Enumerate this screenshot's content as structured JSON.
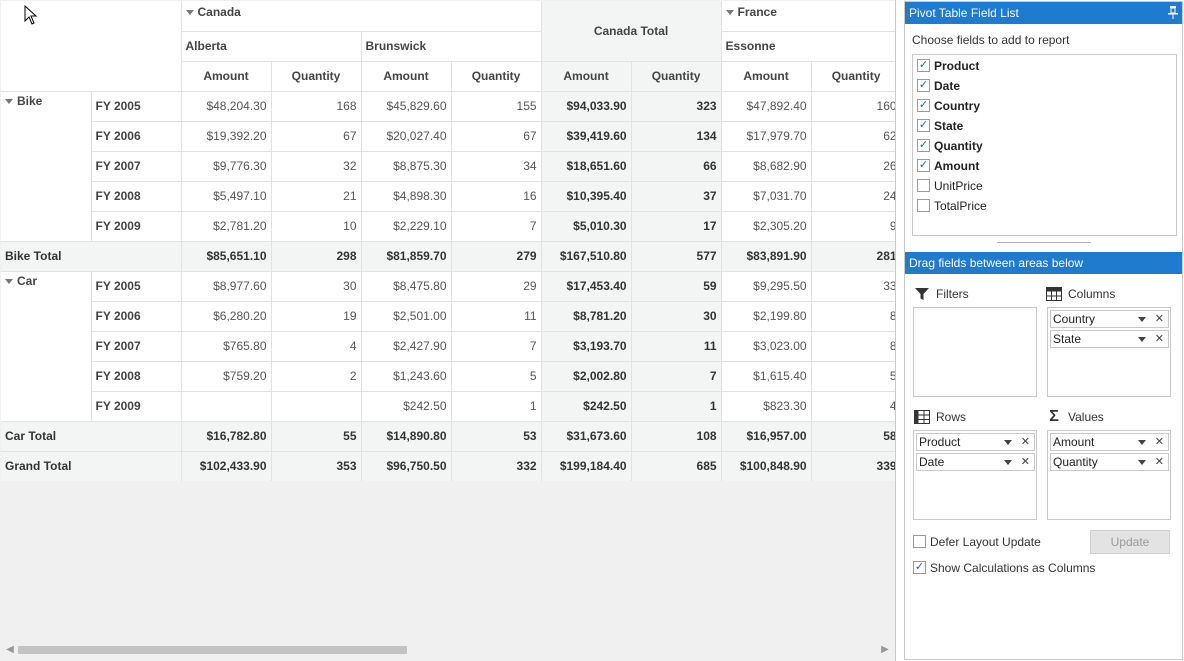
{
  "grid": {
    "col_groups": {
      "canada": "Canada",
      "canada_total": "Canada Total",
      "france": "France"
    },
    "states": {
      "alberta": "Alberta",
      "brunswick": "Brunswick",
      "essonne": "Essonne"
    },
    "measures": {
      "amount": "Amount",
      "quantity": "Quantity"
    },
    "rows": [
      {
        "product": "Bike",
        "year": "FY 2005",
        "values": [
          "$48,204.30",
          "168",
          "$45,829.60",
          "155",
          "$94,033.90",
          "323",
          "$47,892.40",
          "160"
        ]
      },
      {
        "product": "",
        "year": "FY 2006",
        "values": [
          "$19,392.20",
          "67",
          "$20,027.40",
          "67",
          "$39,419.60",
          "134",
          "$17,979.70",
          "62"
        ]
      },
      {
        "product": "",
        "year": "FY 2007",
        "values": [
          "$9,776.30",
          "32",
          "$8,875.30",
          "34",
          "$18,651.60",
          "66",
          "$8,682.90",
          "26"
        ]
      },
      {
        "product": "",
        "year": "FY 2008",
        "values": [
          "$5,497.10",
          "21",
          "$4,898.30",
          "16",
          "$10,395.40",
          "37",
          "$7,031.70",
          "24"
        ]
      },
      {
        "product": "",
        "year": "FY 2009",
        "values": [
          "$2,781.20",
          "10",
          "$2,229.10",
          "7",
          "$5,010.30",
          "17",
          "$2,305.20",
          "9"
        ]
      },
      {
        "total": "Bike Total",
        "values": [
          "$85,651.10",
          "298",
          "$81,859.70",
          "279",
          "$167,510.80",
          "577",
          "$83,891.90",
          "281"
        ]
      },
      {
        "product": "Car",
        "year": "FY 2005",
        "values": [
          "$8,977.60",
          "30",
          "$8,475.80",
          "29",
          "$17,453.40",
          "59",
          "$9,295.50",
          "33"
        ]
      },
      {
        "product": "",
        "year": "FY 2006",
        "values": [
          "$6,280.20",
          "19",
          "$2,501.00",
          "11",
          "$8,781.20",
          "30",
          "$2,199.80",
          "8"
        ]
      },
      {
        "product": "",
        "year": "FY 2007",
        "values": [
          "$765.80",
          "4",
          "$2,427.90",
          "7",
          "$3,193.70",
          "11",
          "$3,023.00",
          "8"
        ]
      },
      {
        "product": "",
        "year": "FY 2008",
        "values": [
          "$759.20",
          "2",
          "$1,243.60",
          "5",
          "$2,002.80",
          "7",
          "$1,615.40",
          "5"
        ]
      },
      {
        "product": "",
        "year": "FY 2009",
        "values": [
          "",
          "",
          "$242.50",
          "1",
          "$242.50",
          "1",
          "$823.30",
          "4"
        ]
      },
      {
        "total": "Car Total",
        "values": [
          "$16,782.80",
          "55",
          "$14,890.80",
          "53",
          "$31,673.60",
          "108",
          "$16,957.00",
          "58"
        ]
      },
      {
        "total": "Grand Total",
        "values": [
          "$102,433.90",
          "353",
          "$96,750.50",
          "332",
          "$199,184.40",
          "685",
          "$100,848.90",
          "339"
        ]
      }
    ]
  },
  "panel": {
    "title": "Pivot Table Field List",
    "choose_label": "Choose fields to add to report",
    "fields": [
      {
        "label": "Product",
        "checked": true
      },
      {
        "label": "Date",
        "checked": true
      },
      {
        "label": "Country",
        "checked": true
      },
      {
        "label": "State",
        "checked": true
      },
      {
        "label": "Quantity",
        "checked": true
      },
      {
        "label": "Amount",
        "checked": true
      },
      {
        "label": "UnitPrice",
        "checked": false
      },
      {
        "label": "TotalPrice",
        "checked": false
      }
    ],
    "drag_label": "Drag fields between areas below",
    "areas": {
      "filters": {
        "title": "Filters",
        "items": []
      },
      "columns": {
        "title": "Columns",
        "items": [
          "Country",
          "State"
        ]
      },
      "rows": {
        "title": "Rows",
        "items": [
          "Product",
          "Date"
        ]
      },
      "values": {
        "title": "Values",
        "items": [
          "Amount",
          "Quantity"
        ]
      }
    },
    "defer_label": "Defer Layout Update",
    "defer_checked": false,
    "show_calc_label": "Show Calculations as Columns",
    "show_calc_checked": true,
    "update_label": "Update",
    "accent_color": "#1e7bd0"
  }
}
